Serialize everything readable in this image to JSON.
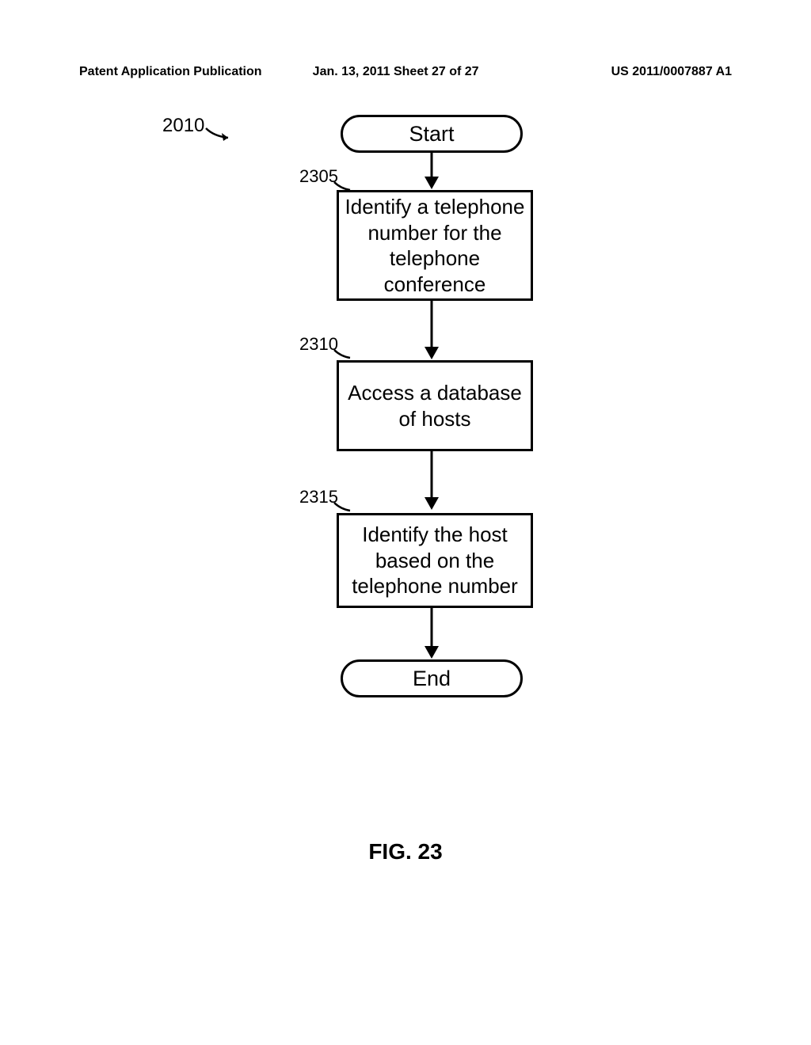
{
  "header": {
    "left": "Patent Application Publication",
    "center": "Jan. 13, 2011  Sheet 27 of 27",
    "right": "US 2011/0007887 A1"
  },
  "refs": {
    "main": "2010",
    "step1": "2305",
    "step2": "2310",
    "step3": "2315"
  },
  "boxes": {
    "start": "Start",
    "step1": "Identify a telephone number for the telephone conference",
    "step2": "Access a database of hosts",
    "step3": "Identify the host based on the telephone number",
    "end": "End"
  },
  "caption": "FIG. 23"
}
